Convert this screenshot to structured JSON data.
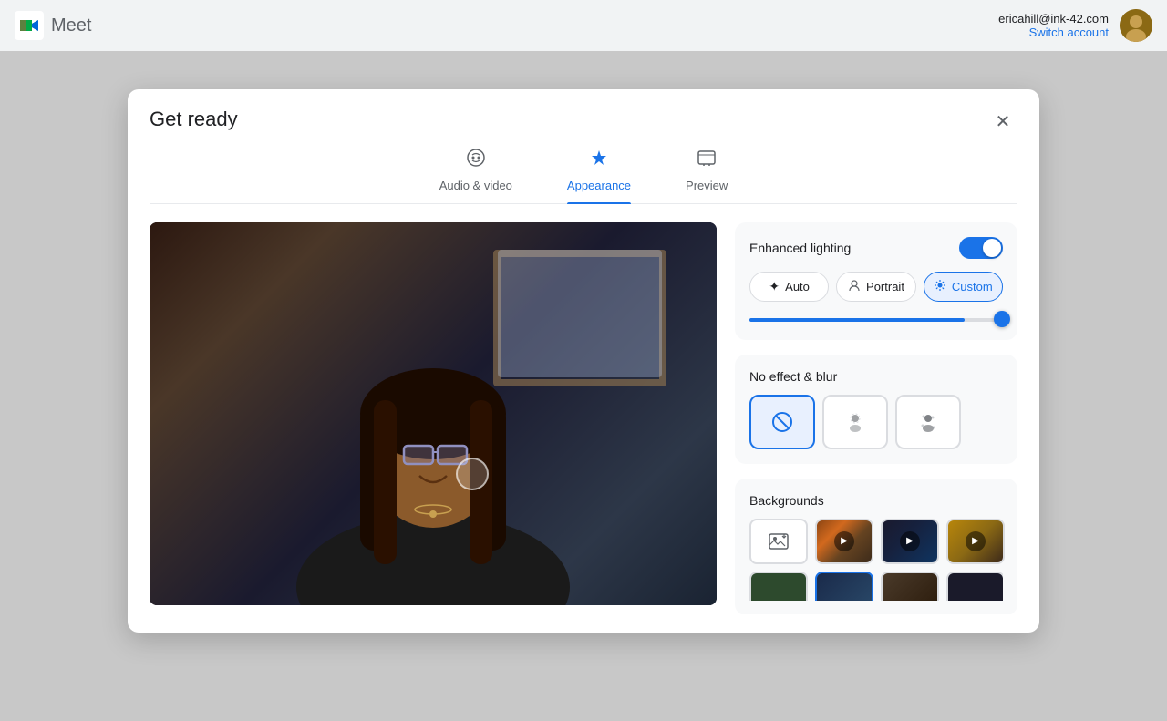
{
  "topbar": {
    "app_name": "Meet",
    "account_email": "ericahill@ink-42.com",
    "switch_account_label": "Switch account"
  },
  "modal": {
    "title": "Get ready",
    "close_label": "✕",
    "tabs": [
      {
        "id": "audio-video",
        "label": "Audio & video",
        "active": false
      },
      {
        "id": "appearance",
        "label": "Appearance",
        "active": true
      },
      {
        "id": "preview",
        "label": "Preview",
        "active": false
      }
    ],
    "lighting": {
      "label": "Enhanced lighting",
      "toggle_on": true,
      "modes": [
        {
          "id": "auto",
          "label": "Auto",
          "icon": "✦",
          "active": false
        },
        {
          "id": "portrait",
          "label": "Portrait",
          "icon": "👤",
          "active": false
        },
        {
          "id": "custom",
          "label": "Custom",
          "icon": "⚙",
          "active": true
        }
      ],
      "slider_value": 85
    },
    "effects": {
      "label": "No effect & blur",
      "options": [
        {
          "id": "no-effect",
          "label": "no effect",
          "icon": "⊘",
          "active": true
        },
        {
          "id": "blur-light",
          "label": "light blur",
          "icon": "👤",
          "active": false
        },
        {
          "id": "blur-heavy",
          "label": "heavy blur",
          "icon": "⠿",
          "active": false
        }
      ]
    },
    "backgrounds": {
      "label": "Backgrounds",
      "items": [
        {
          "id": "upload",
          "type": "upload",
          "icon": "🖼"
        },
        {
          "id": "bg1",
          "type": "image",
          "color": "warm-brown",
          "animated": true
        },
        {
          "id": "bg2",
          "type": "image",
          "color": "dark-blue",
          "animated": true
        },
        {
          "id": "bg3",
          "type": "image",
          "color": "golden-brown",
          "animated": true
        }
      ]
    }
  }
}
